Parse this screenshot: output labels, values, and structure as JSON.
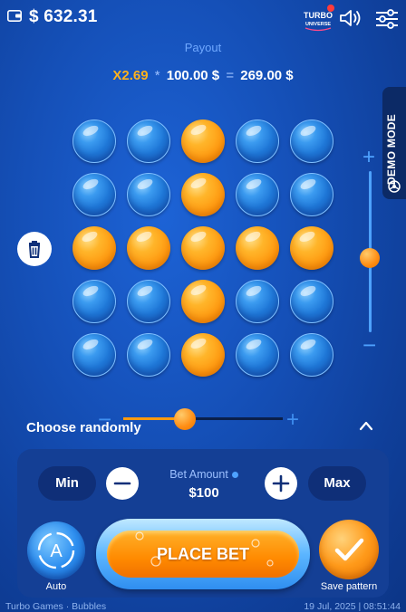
{
  "header": {
    "balance": "$ 632.31",
    "logo_top": "TURBO",
    "logo_bottom": "UNIVERSE"
  },
  "payout": {
    "label": "Payout",
    "multiplier": "X2.69",
    "times": "*",
    "bet": "100.00 $",
    "equals": "=",
    "result": "269.00 $"
  },
  "demo_mode": {
    "label": "DEMO MODE"
  },
  "grid": {
    "rows": [
      [
        "blue",
        "blue",
        "orange",
        "blue",
        "blue"
      ],
      [
        "blue",
        "blue",
        "orange",
        "blue",
        "blue"
      ],
      [
        "orange",
        "orange",
        "orange",
        "orange",
        "orange"
      ],
      [
        "blue",
        "blue",
        "orange",
        "blue",
        "blue"
      ],
      [
        "blue",
        "blue",
        "orange",
        "blue",
        "blue"
      ]
    ]
  },
  "vertical_slider": {
    "plus": "+",
    "minus": "−",
    "level": 0.52
  },
  "horizontal_slider": {
    "minus": "−",
    "plus": "+",
    "level": 0.39
  },
  "controls": {
    "choose_randomly": "Choose randomly",
    "min_label": "Min",
    "max_label": "Max",
    "bet_amount_label": "Bet Amount",
    "bet_amount_value": "$100",
    "auto_letter": "A",
    "auto_label": "Auto",
    "place_bet_label": "PLACE BET",
    "save_pattern_label": "Save pattern"
  },
  "footer": {
    "left": "Turbo Games · Bubbles",
    "right": "19 Jul, 2025 | 08:51:44"
  },
  "colors": {
    "background": "#1550b8",
    "accent_orange": "#ff9a10",
    "accent_blue": "#4ea2ff",
    "multiplier": "#ffb21d"
  }
}
